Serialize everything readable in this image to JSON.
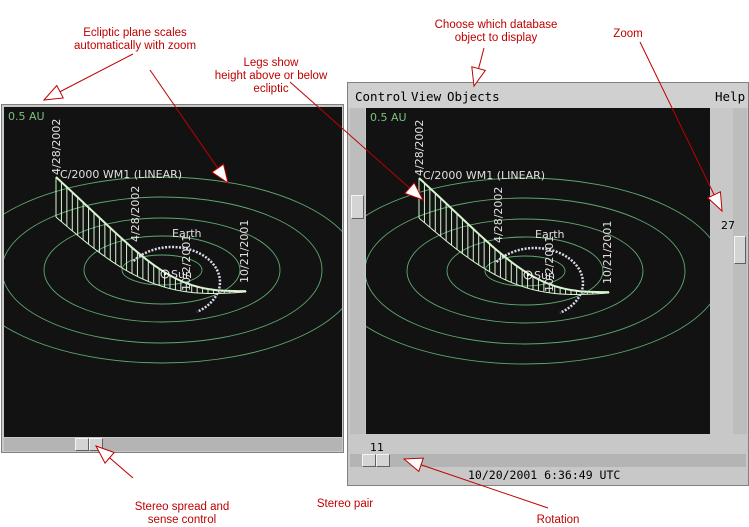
{
  "annotations": {
    "ecliptic": [
      "Ecliptic plane scales",
      "automatically with zoom"
    ],
    "legs": [
      "Legs show",
      "height above or below",
      "ecliptic"
    ],
    "choose": [
      "Choose which database",
      "object to display"
    ],
    "zoom": "Zoom",
    "stereo_spread": [
      "Stereo spread and",
      "sense control"
    ],
    "stereo_pair": "Stereo pair",
    "rotation": "Rotation"
  },
  "left_window": {
    "scale_label": "0.5 AU"
  },
  "right_window": {
    "scale_label": "0.5 AU",
    "menu": {
      "control": "Control",
      "view": "View",
      "objects": "Objects",
      "help": "Help"
    },
    "zoom_value": "27",
    "rotation_value": "11",
    "status": "10/20/2001   6:36:49 UTC"
  },
  "plot": {
    "comet_label": "C/2000 WM1 (LINEAR)",
    "earth_label": "Earth",
    "sun_label": "Sun",
    "dates": [
      "4/28/2002",
      "4/28/2002",
      "10/21/2001",
      "10/2/2001"
    ]
  },
  "colors": {
    "orbit": "#5fa86f",
    "comet": "#d8f5d0",
    "earth": "#d8d8e8",
    "annotation": "#c00000",
    "background": "#121212"
  }
}
